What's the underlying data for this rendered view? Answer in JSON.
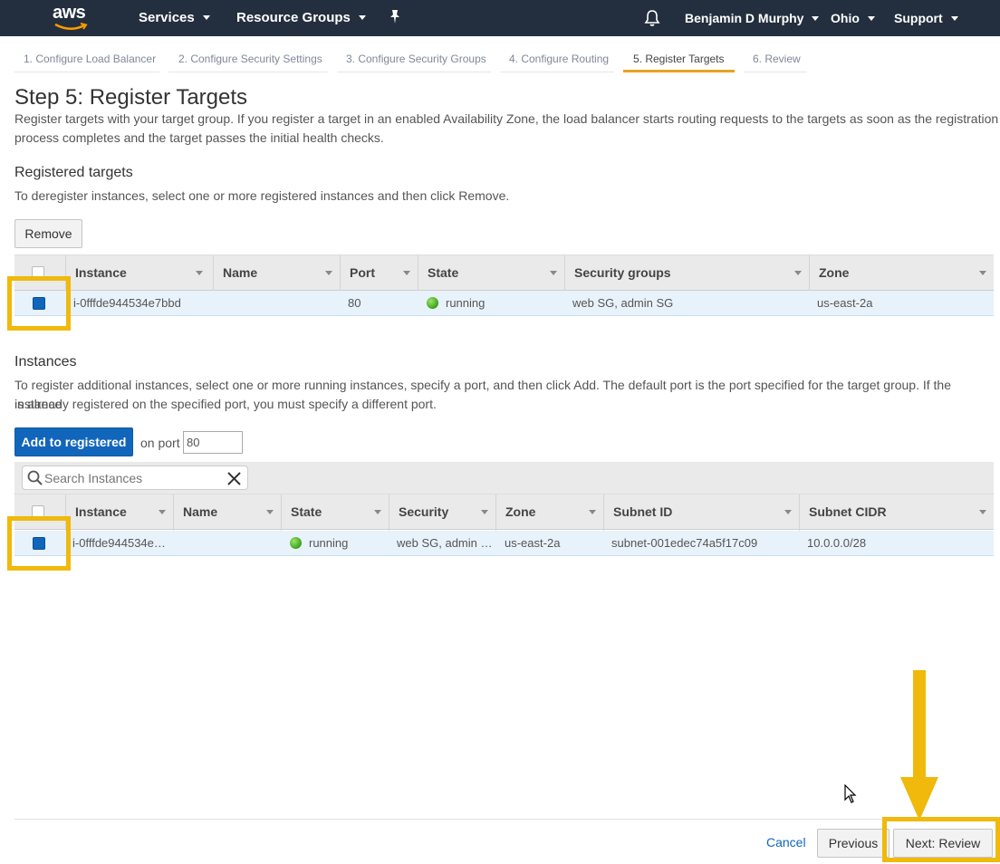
{
  "colors": {
    "nav_bg": "#232f3e",
    "accent": "#e7a320",
    "primary": "#1166bb",
    "highlight": "#f0b90b",
    "status_running": "#3aa31a"
  },
  "nav": {
    "logo": "aws",
    "services": "Services",
    "resource_groups": "Resource Groups",
    "user": "Benjamin D Murphy",
    "region": "Ohio",
    "support": "Support",
    "icons": [
      "aws-logo",
      "pin-icon",
      "bell-icon"
    ]
  },
  "wizard_tabs": [
    "1. Configure Load Balancer",
    "2. Configure Security Settings",
    "3. Configure Security Groups",
    "4. Configure Routing",
    "5. Register Targets",
    "6. Review"
  ],
  "active_tab_index": 4,
  "page": {
    "title": "Step 5: Register Targets",
    "description_line1": "Register targets with your target group. If you register a target in an enabled Availability Zone, the load balancer starts routing requests to the targets as soon as the registration",
    "description_line2": "process completes and the target passes the initial health checks."
  },
  "registered": {
    "heading": "Registered targets",
    "help": "To deregister instances, select one or more registered instances and then click Remove.",
    "remove_label": "Remove",
    "columns": [
      "Instance",
      "Name",
      "Port",
      "State",
      "Security groups",
      "Zone"
    ],
    "row": {
      "instance": "i-0fffde944534e7bbd",
      "name": "",
      "port": "80",
      "state": "running",
      "security_groups": "web SG, admin SG",
      "zone": "us-east-2a",
      "checked": true
    }
  },
  "instances": {
    "heading": "Instances",
    "help_line1": "To register additional instances, select one or more running instances, specify a port, and then click Add. The default port is the port specified for the target group. If the instance",
    "help_line2": "is already registered on the specified port, you must specify a different port.",
    "add_label": "Add to registered",
    "on_port_label": "on port",
    "port_value": "80",
    "search_placeholder": "Search Instances",
    "columns": [
      "Instance",
      "Name",
      "State",
      "Security",
      "Zone",
      "Subnet ID",
      "Subnet CIDR"
    ],
    "row": {
      "instance": "i-0fffde944534e…",
      "name": "",
      "state": "running",
      "security": "web SG, admin …",
      "zone": "us-east-2a",
      "subnet_id": "subnet-001edec74a5f17c09",
      "subnet_cidr": "10.0.0.0/28",
      "checked": true
    }
  },
  "footer": {
    "cancel": "Cancel",
    "previous": "Previous",
    "next": "Next: Review"
  }
}
